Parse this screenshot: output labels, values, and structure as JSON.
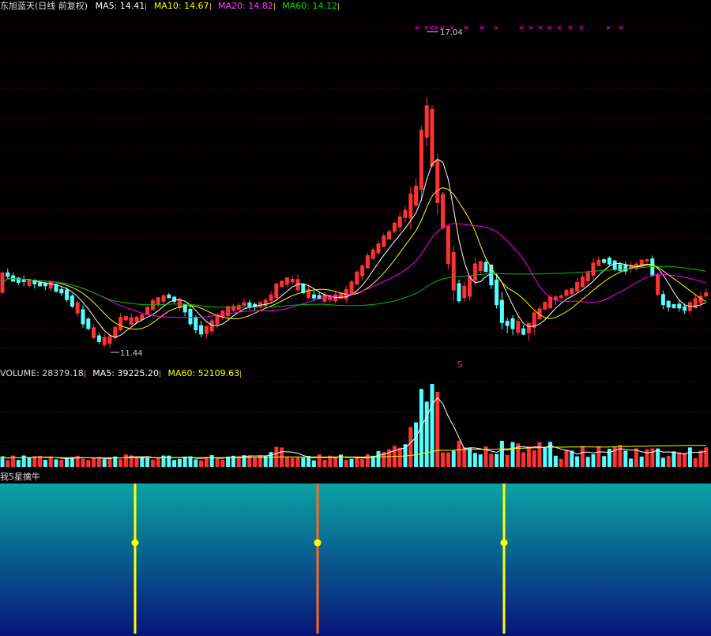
{
  "header": {
    "stock_name": "东旭蓝天(日线 前复权)",
    "ma5": "MA5: 14.41",
    "ma10": "MA10: 14.67",
    "ma20": "MA20: 14.82",
    "ma60": "MA60: 14.12"
  },
  "volume_header": {
    "volume": "VOLUME: 28379.18",
    "ma5": "MA5: 39225.20",
    "ma60": "MA60: 52109.63"
  },
  "indicator_header": {
    "title": "我5星擒牛"
  },
  "annotations": {
    "high_label": "17.04",
    "low_label": "11.44",
    "sell_mark": "S"
  },
  "colors": {
    "up": "#ff3232",
    "down": "#54ffff",
    "ma5": "#ffffff",
    "ma10": "#ffff00",
    "ma20": "#ff00ff",
    "ma60": "#00c000",
    "grid": "#7a0000",
    "marker_x": "#ff00ff",
    "signal_yellow": "#ffff00",
    "signal_orange": "#ff6a1a",
    "indicator_top": "#0aa3a3",
    "indicator_bottom": "#08147a"
  },
  "chart_data": {
    "type": "candlestick",
    "title": "东旭蓝天(日线 前复权)",
    "price_range": [
      11.0,
      17.5
    ],
    "high": 17.04,
    "low": 11.44,
    "latest_ma": {
      "MA5": 14.41,
      "MA10": 14.67,
      "MA20": 14.82,
      "MA60": 14.12
    },
    "volume": {
      "latest": 28379.18,
      "MA5": 39225.2,
      "MA60": 52109.63
    },
    "indicator": {
      "name": "我5星擒牛",
      "signals_yellow": 2,
      "signals_orange": 1
    }
  }
}
